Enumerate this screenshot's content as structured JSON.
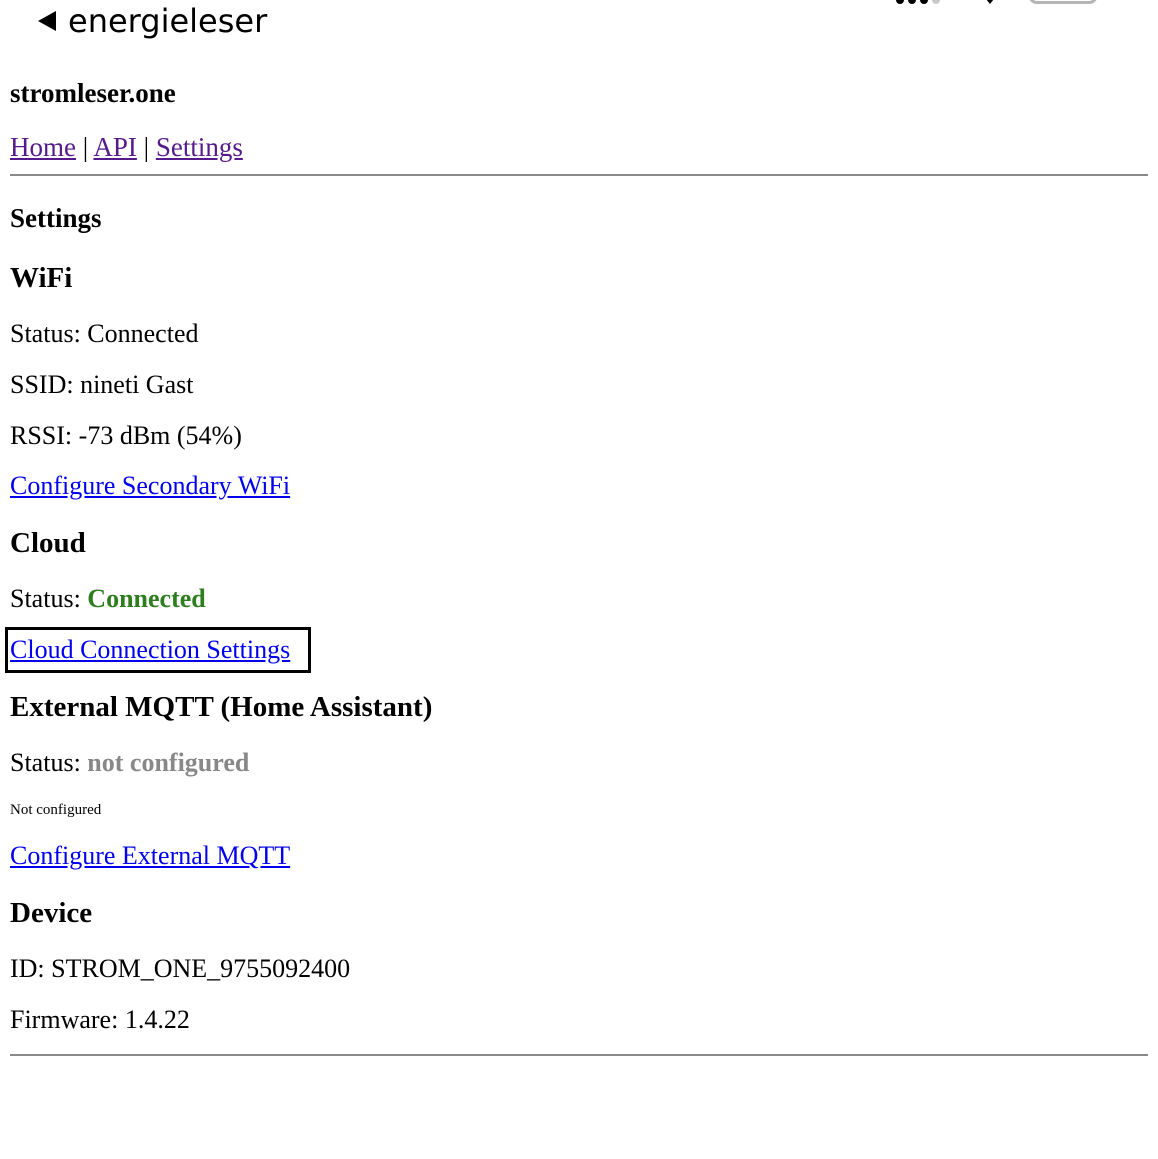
{
  "statusbar": {
    "back_label": "energieleser"
  },
  "header": {
    "site_title": "stromleser.one"
  },
  "nav": {
    "items": [
      "Home",
      "API",
      "Settings"
    ],
    "separator": "|"
  },
  "page": {
    "title": "Settings"
  },
  "wifi": {
    "heading": "WiFi",
    "status_label": "Status:",
    "status_value": "Connected",
    "ssid_label": "SSID:",
    "ssid_value": "nineti Gast",
    "rssi_label": "RSSI:",
    "rssi_value": "-73 dBm (54%)",
    "configure_link": "Configure Secondary WiFi"
  },
  "cloud": {
    "heading": "Cloud",
    "status_label": "Status:",
    "status_value": "Connected",
    "status_color": "#2e7d1e",
    "settings_link": "Cloud Connection Settings"
  },
  "mqtt": {
    "heading": "External MQTT (Home Assistant)",
    "status_label": "Status:",
    "status_value": "not configured",
    "status_color": "#888888",
    "note": "Not configured",
    "configure_link": "Configure External MQTT"
  },
  "device": {
    "heading": "Device",
    "id_label": "ID:",
    "id_value": "STROM_ONE_9755092400",
    "firmware_label": "Firmware:",
    "firmware_value": "1.4.22"
  },
  "colors": {
    "visited_link": "#551a8b",
    "link": "#0000ee",
    "rule": "#8a8a8a"
  }
}
